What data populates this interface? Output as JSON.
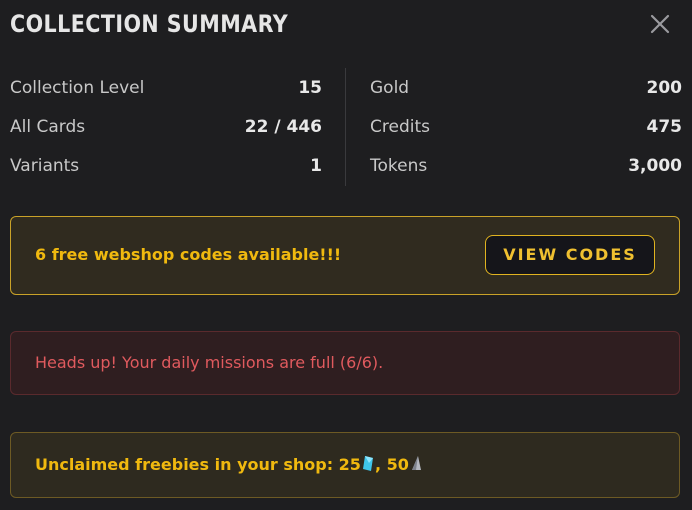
{
  "header": {
    "title": "COLLECTION SUMMARY",
    "close_icon": "close-icon"
  },
  "stats": {
    "left": [
      {
        "label": "Collection Level",
        "value": "15"
      },
      {
        "label": "All Cards",
        "value": "22 / 446"
      },
      {
        "label": "Variants",
        "value": "1"
      }
    ],
    "right": [
      {
        "label": "Gold",
        "value": "200"
      },
      {
        "label": "Credits",
        "value": "475"
      },
      {
        "label": "Tokens",
        "value": "3,000"
      }
    ]
  },
  "webshop": {
    "message": "6 free webshop codes available!!!",
    "button_label": "VIEW CODES"
  },
  "missions": {
    "message": "Heads up! Your daily missions are full (6/6)."
  },
  "freebies": {
    "prefix": "Unclaimed freebies in your shop: ",
    "gem_amount": "25",
    "separator": ", ",
    "shard_amount": "50",
    "gem_icon": "gem-icon",
    "shard_icon": "shard-icon"
  },
  "colors": {
    "background": "#1e1e20",
    "gold_accent": "#f0b90f",
    "alert_red": "#e05a5e"
  }
}
